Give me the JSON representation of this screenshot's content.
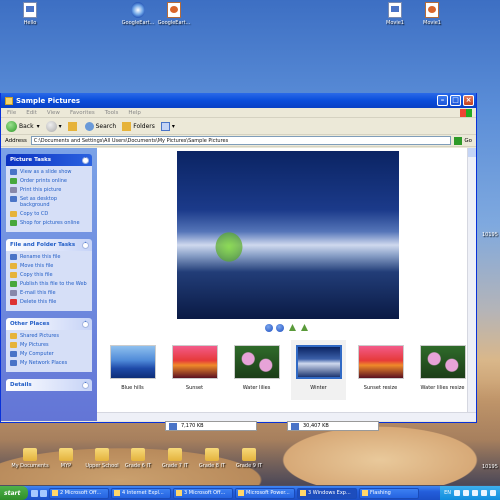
{
  "desktop": {
    "top_icons": [
      "Hello",
      "GoogleEart...",
      "GoogleEart...",
      "Movie1",
      "Movie1"
    ],
    "bottom_icons": [
      "My Documents",
      "MYP",
      "Upper School",
      "Grade 6 IT",
      "Grade 7 IT",
      "Grade 8 IT",
      "Grade 9 IT"
    ],
    "right_edge": [
      "10195",
      "10195"
    ]
  },
  "window": {
    "title": "Sample Pictures",
    "menu": [
      "File",
      "Edit",
      "View",
      "Favorites",
      "Tools",
      "Help"
    ],
    "toolbar": {
      "back": "Back",
      "search": "Search",
      "folders": "Folders"
    },
    "address": {
      "label": "Address",
      "value": "C:\\Documents and Settings\\All Users\\Documents\\My Pictures\\Sample Pictures",
      "go": "Go"
    }
  },
  "taskpane": {
    "picture_tasks": {
      "title": "Picture Tasks",
      "items": [
        "View as a slide show",
        "Order prints online",
        "Print this picture",
        "Set as desktop background",
        "Copy to CD",
        "Shop for pictures online"
      ]
    },
    "file_tasks": {
      "title": "File and Folder Tasks",
      "items": [
        "Rename this file",
        "Move this file",
        "Copy this file",
        "Publish this file to the Web",
        "E-mail this file",
        "Delete this file"
      ]
    },
    "other_places": {
      "title": "Other Places",
      "items": [
        "Shared Pictures",
        "My Pictures",
        "My Computer",
        "My Network Places"
      ]
    },
    "details": {
      "title": "Details"
    }
  },
  "filmstrip": {
    "thumbnails": [
      "Blue hills",
      "Sunset",
      "Water lilies",
      "Winter",
      "Sunset resize",
      "Water lilies resize"
    ],
    "selected": "Winter"
  },
  "statusbar": {
    "left_size": "7,170 KB",
    "right_size": "30,407 KB"
  },
  "taskbar": {
    "start": "start",
    "tasks": [
      "2 Microsoft Off...",
      "4 Internet Expl...",
      "3 Microsoft Off...",
      "Microsoft Power...",
      "3 Windows Exp...",
      "Flashing"
    ],
    "language": "EN"
  },
  "colors": {
    "xp_blue": "#0a4ddb",
    "taskpane_blue": "#6375d6",
    "link_blue": "#215dc6"
  }
}
